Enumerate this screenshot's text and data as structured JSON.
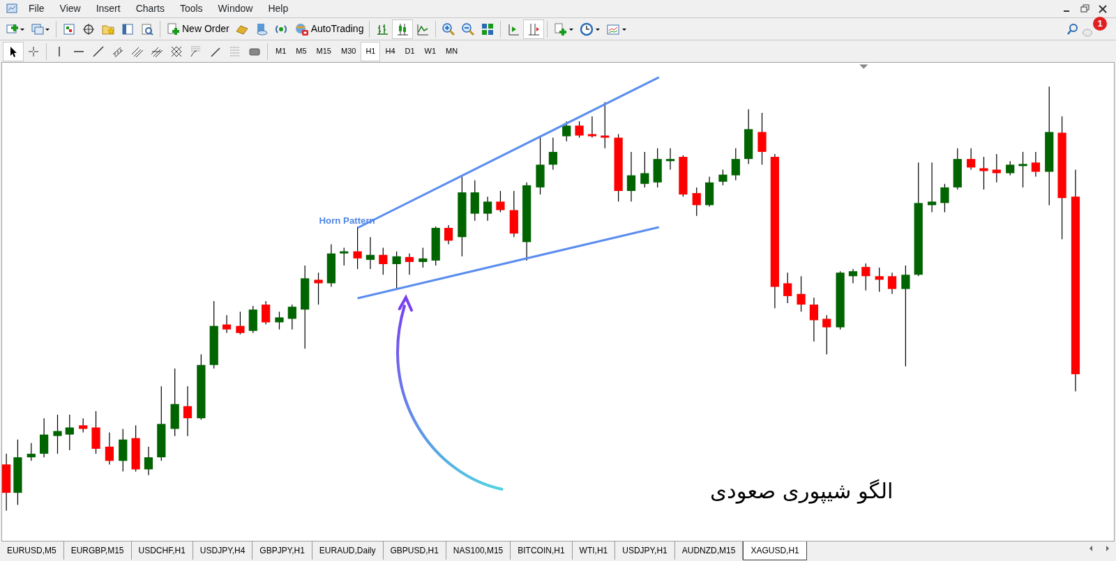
{
  "menu": [
    {
      "label": "File"
    },
    {
      "label": "View"
    },
    {
      "label": "Insert"
    },
    {
      "label": "Charts"
    },
    {
      "label": "Tools"
    },
    {
      "label": "Window"
    },
    {
      "label": "Help"
    }
  ],
  "toolbar": {
    "buttons": [
      {
        "label": "New Order"
      },
      {
        "label": "AutoTrading"
      }
    ]
  },
  "timeframes": [
    {
      "label": "M1",
      "selected": false
    },
    {
      "label": "M5",
      "selected": false
    },
    {
      "label": "M15",
      "selected": false
    },
    {
      "label": "M30",
      "selected": false
    },
    {
      "label": "H1",
      "selected": true
    },
    {
      "label": "H4",
      "selected": false
    },
    {
      "label": "D1",
      "selected": false
    },
    {
      "label": "W1",
      "selected": false
    },
    {
      "label": "MN",
      "selected": false
    }
  ],
  "notifications": {
    "count": "1"
  },
  "chart": {
    "pattern_label": "Horn Pattern",
    "caption": "الگو شیپوری صعودی"
  },
  "tabs": [
    {
      "label": "EURUSD,M5",
      "selected": false
    },
    {
      "label": "EURGBP,M15",
      "selected": false
    },
    {
      "label": "USDCHF,H1",
      "selected": false
    },
    {
      "label": "USDJPY,H4",
      "selected": false
    },
    {
      "label": "GBPJPY,H1",
      "selected": false
    },
    {
      "label": "EURAUD,Daily",
      "selected": false
    },
    {
      "label": "GBPUSD,H1",
      "selected": false
    },
    {
      "label": "NAS100,M15",
      "selected": false
    },
    {
      "label": "BITCOIN,H1",
      "selected": false
    },
    {
      "label": "WTI,H1",
      "selected": false
    },
    {
      "label": "USDJPY,H1",
      "selected": false
    },
    {
      "label": "AUDNZD,M15",
      "selected": false
    },
    {
      "label": "XAGUSD,H1",
      "selected": true
    }
  ]
}
